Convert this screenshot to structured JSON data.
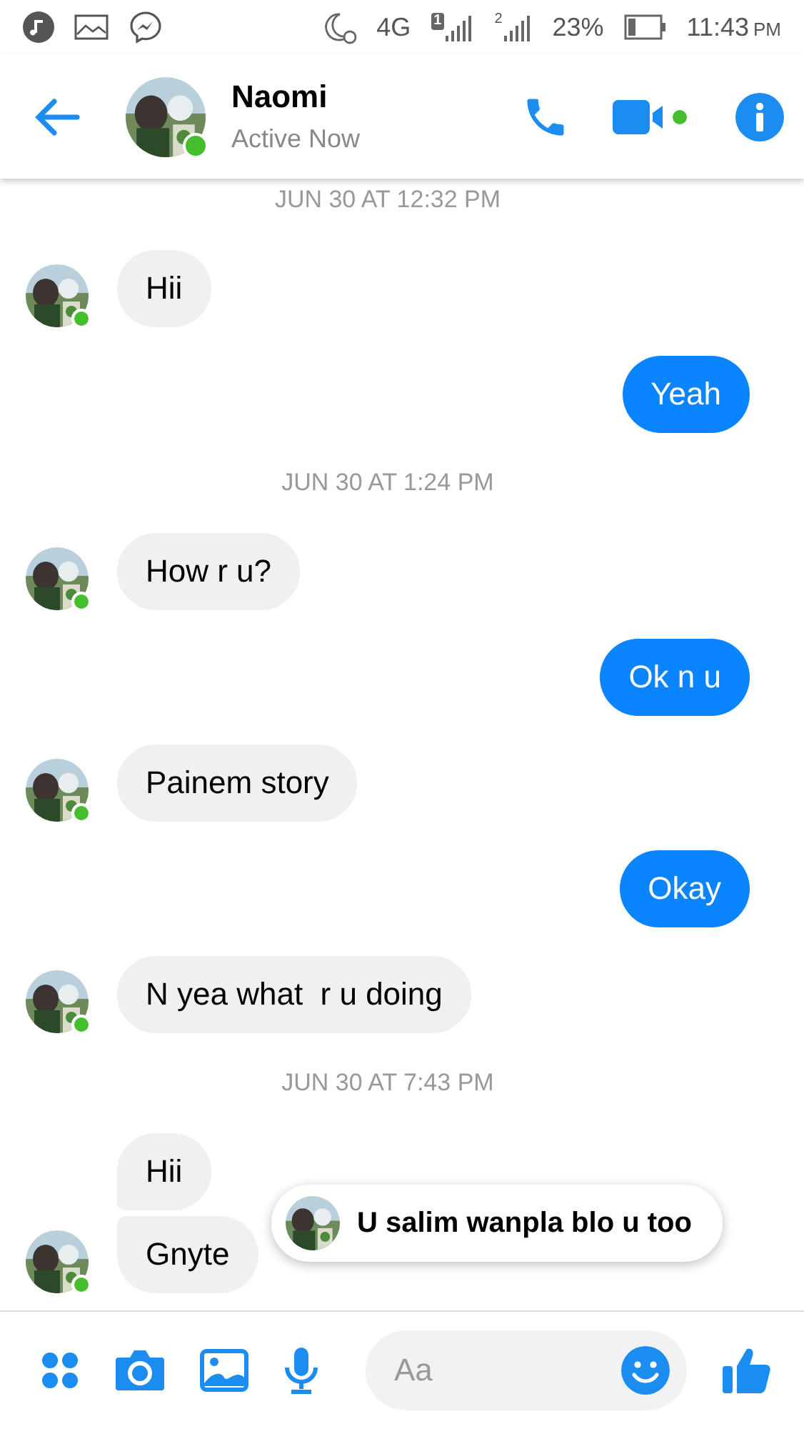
{
  "status_bar": {
    "network": "4G",
    "sim1": "1",
    "sim2": "2",
    "battery": "23%",
    "time": "11:43",
    "period": "PM"
  },
  "header": {
    "name": "Naomi",
    "status": "Active Now",
    "online": true
  },
  "messages": [
    {
      "kind": "timestamp",
      "text": "JUN 30 AT 12:32 PM"
    },
    {
      "kind": "received",
      "text": "Hii",
      "avatar": true
    },
    {
      "kind": "sent",
      "text": "Yeah"
    },
    {
      "kind": "timestamp",
      "text": "JUN 30 AT 1:24 PM"
    },
    {
      "kind": "received",
      "text": "How r u?",
      "avatar": true
    },
    {
      "kind": "sent",
      "text": "Ok n u"
    },
    {
      "kind": "received",
      "text": "Painem story",
      "avatar": true
    },
    {
      "kind": "sent",
      "text": "Okay"
    },
    {
      "kind": "received",
      "text": "N yea what  r u doing",
      "avatar": true
    },
    {
      "kind": "timestamp",
      "text": "JUN 30 AT 7:43 PM"
    },
    {
      "kind": "received",
      "text": "Hii",
      "avatar": false
    },
    {
      "kind": "received",
      "text": "Gnyte",
      "avatar": true
    }
  ],
  "toast": {
    "text": "U salim wanpla blo u too"
  },
  "composer": {
    "placeholder": "Aa"
  }
}
